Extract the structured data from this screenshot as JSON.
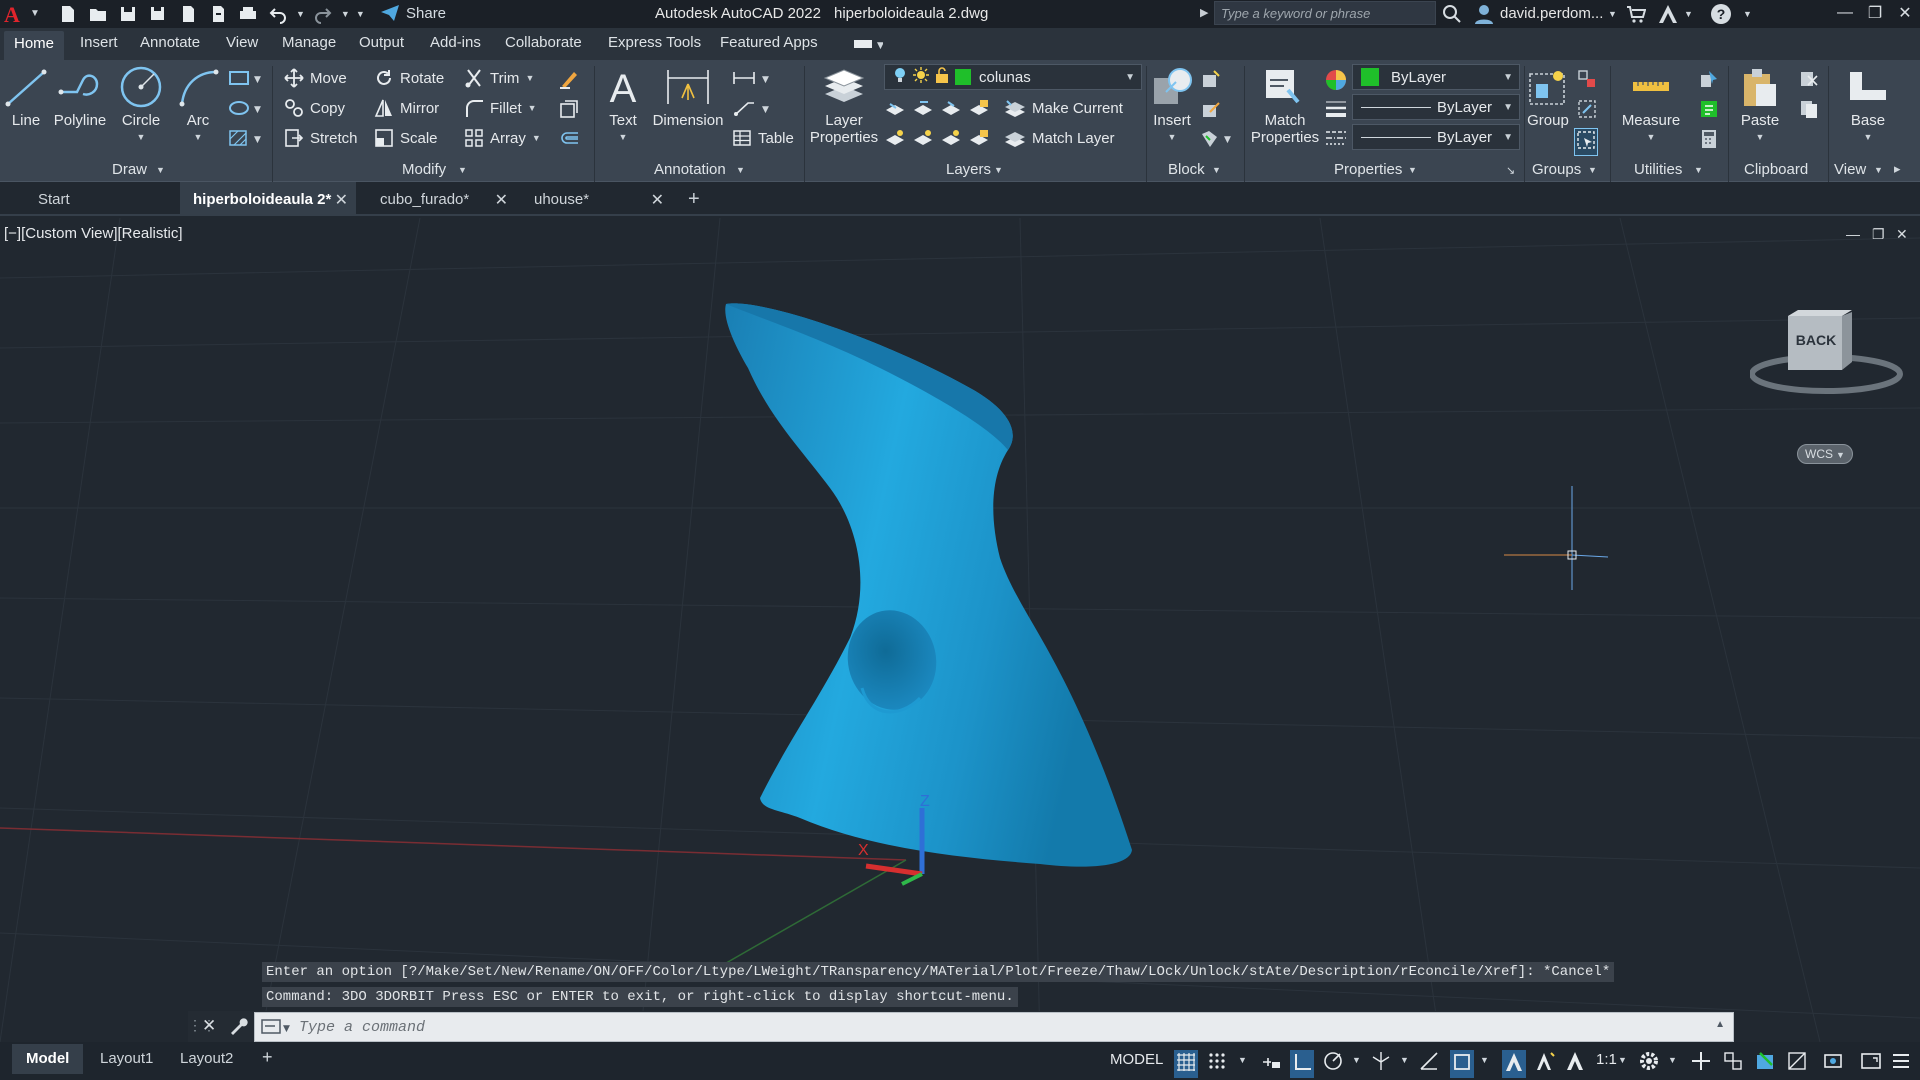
{
  "app": {
    "title": "Autodesk AutoCAD 2022",
    "file_title": "hiperboloideaula 2.dwg",
    "logo": "A",
    "share_label": "Share",
    "search_placeholder": "Type a keyword or phrase",
    "user_name": "david.perdom..."
  },
  "ribbon_tabs": [
    "Home",
    "Insert",
    "Annotate",
    "View",
    "Manage",
    "Output",
    "Add-ins",
    "Collaborate",
    "Express Tools",
    "Featured Apps"
  ],
  "draw": {
    "panel": "Draw",
    "line": "Line",
    "polyline": "Polyline",
    "circle": "Circle",
    "arc": "Arc"
  },
  "modify": {
    "panel": "Modify",
    "move": "Move",
    "rotate": "Rotate",
    "trim": "Trim",
    "copy": "Copy",
    "mirror": "Mirror",
    "fillet": "Fillet",
    "stretch": "Stretch",
    "scale": "Scale",
    "array": "Array"
  },
  "annotation": {
    "panel": "Annotation",
    "text": "Text",
    "dimension": "Dimension",
    "table": "Table"
  },
  "layers": {
    "panel": "Layers",
    "layer_properties": "Layer\nProperties",
    "current_layer": "colunas",
    "make_current": "Make Current",
    "match_layer": "Match Layer"
  },
  "block": {
    "panel": "Block",
    "insert": "Insert"
  },
  "properties": {
    "panel": "Properties",
    "match_properties": "Match\nProperties",
    "color": "ByLayer",
    "linetype": "ByLayer",
    "lineweight": "ByLayer"
  },
  "groups": {
    "panel": "Groups",
    "group": "Group"
  },
  "utilities": {
    "panel": "Utilities",
    "measure": "Measure"
  },
  "clipboard": {
    "panel": "Clipboard",
    "paste": "Paste"
  },
  "view": {
    "panel": "View",
    "base": "Base"
  },
  "file_tabs": [
    "Start",
    "hiperboloideaula 2*",
    "cubo_furado*",
    "uhouse*"
  ],
  "viewport": {
    "label": "[−][Custom View][Realistic]",
    "viewcube_face": "BACK",
    "wcs": "WCS",
    "z_axis": "Z",
    "x_axis": "X"
  },
  "command": {
    "history_1": "Enter an option [?/Make/Set/New/Rename/ON/OFF/Color/Ltype/LWeight/TRansparency/MATerial/Plot/Freeze/Thaw/LOck/Unlock/stAte/Description/rEconcile/Xref]: *Cancel*",
    "history_2": "Command: 3DO 3DORBIT Press ESC or ENTER to exit, or right-click to display shortcut-menu.",
    "placeholder": "Type a command"
  },
  "layout_tabs": [
    "Model",
    "Layout1",
    "Layout2"
  ],
  "status": {
    "model": "MODEL",
    "scale": "1:1"
  },
  "colors": {
    "accent_blue": "#1a8fc8",
    "layer_green": "#1fbf2a",
    "logo_red": "#e0242c",
    "background": "#212830"
  }
}
